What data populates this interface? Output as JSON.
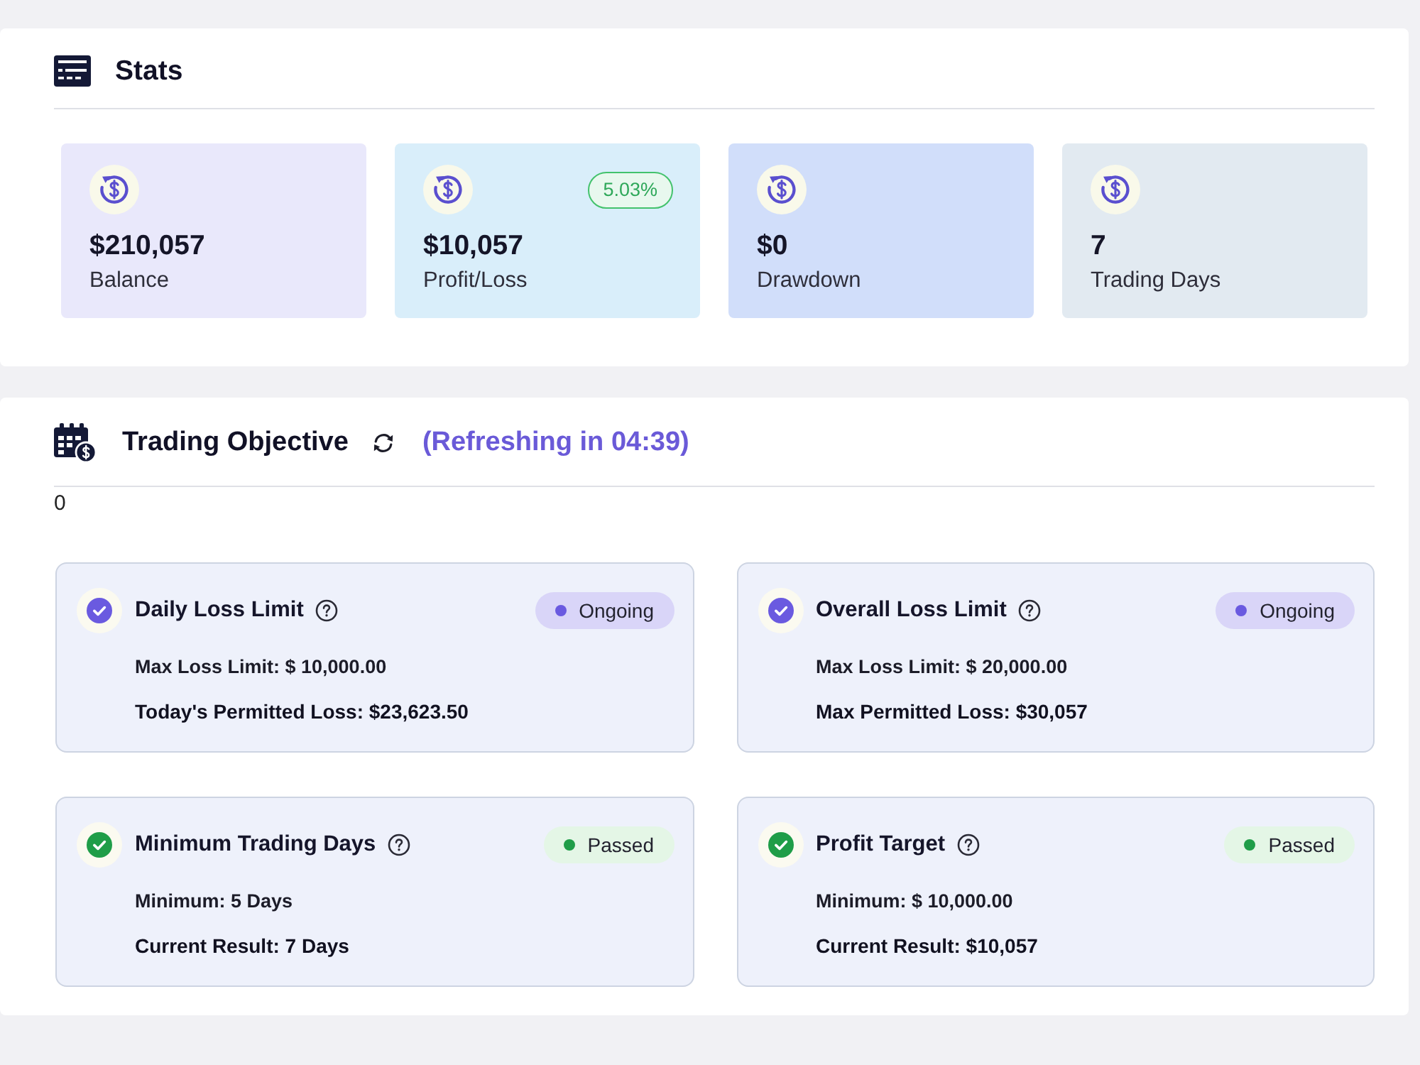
{
  "stats": {
    "title": "Stats",
    "cards": [
      {
        "value": "$210,057",
        "label": "Balance",
        "color": "#e9e8fb"
      },
      {
        "value": "$10,057",
        "label": "Profit/Loss",
        "color": "#d9eefa",
        "badge": "5.03%"
      },
      {
        "value": "$0",
        "label": "Drawdown",
        "color": "#d1defa"
      },
      {
        "value": "7",
        "label": "Trading Days",
        "color": "#e2eaf1"
      }
    ]
  },
  "trading_objective": {
    "title": "Trading Objective",
    "refresh_note": "(Refreshing in 04:39)",
    "note": "0",
    "cards": [
      {
        "title": "Daily Loss Limit",
        "kind": "ongoing",
        "status": "Ongoing",
        "requirement": "Max Loss Limit: $ 10,000.00",
        "result": "Today's Permitted Loss: $23,623.50"
      },
      {
        "title": "Overall Loss Limit",
        "kind": "ongoing",
        "status": "Ongoing",
        "requirement": "Max Loss Limit: $ 20,000.00",
        "result": "Max Permitted Loss: $30,057"
      },
      {
        "title": "Minimum Trading Days",
        "kind": "passed",
        "status": "Passed",
        "requirement": "Minimum: 5 Days",
        "result": "Current Result: 7 Days"
      },
      {
        "title": "Profit Target",
        "kind": "passed",
        "status": "Passed",
        "requirement": "Minimum: $ 10,000.00",
        "result": "Current Result: $10,057"
      }
    ]
  }
}
